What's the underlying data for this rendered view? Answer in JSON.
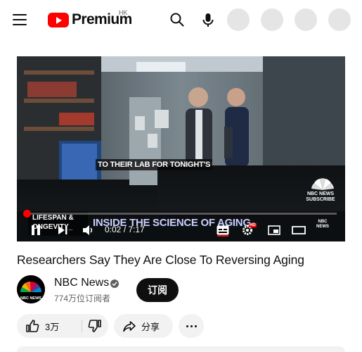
{
  "header": {
    "logo_text": "Premium",
    "region": "HK",
    "icons": [
      "menu-icon",
      "search-icon",
      "mic-icon"
    ],
    "brand_color": "#ff0000"
  },
  "player": {
    "caption": "TO THEIR LAB FOR TONIGHT'S",
    "lower_third": {
      "left_line1": "LIFESPAN &",
      "left_line2": "ONGEVITY_",
      "title": "INSIDE THE SCIENCE OF AGING"
    },
    "watermark": {
      "line1": "NBC NEWS",
      "line2": "SUBSCRIBE",
      "end": "NBC NEWS"
    },
    "time": "0:02 / 7:17",
    "progress_fraction": 0.005,
    "quality_badge": "HD",
    "controls": [
      "pause-icon",
      "next-icon",
      "volume-icon",
      "subtitles-icon",
      "settings-icon",
      "miniplayer-icon",
      "theater-icon"
    ]
  },
  "video": {
    "title": "Researchers Say They Are Close To Reversing Aging",
    "channel": "NBC News",
    "channel_verified": true,
    "subscribers": "774万位订阅者",
    "subscribe_label": "订阅",
    "avatar_text": "NBC NEWS"
  },
  "actions": {
    "like_count": "3万",
    "share_label": "分享"
  }
}
